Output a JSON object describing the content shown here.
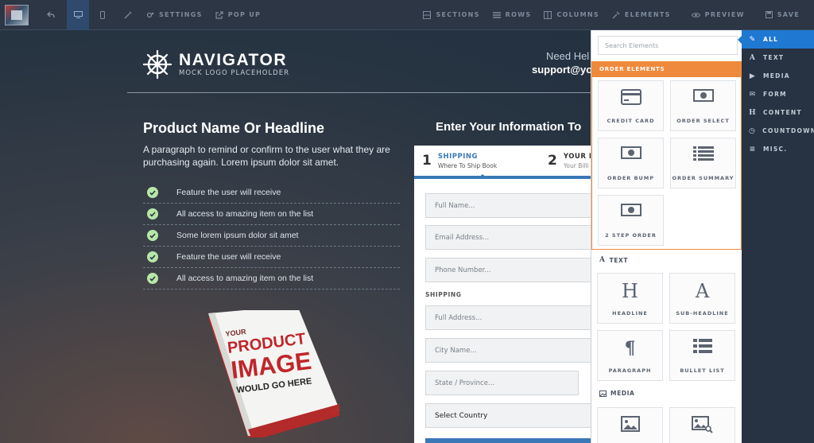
{
  "toolbar": {
    "settings_label": "SETTINGS",
    "popup_label": "POP UP",
    "sections_label": "SECTIONS",
    "rows_label": "ROWS",
    "columns_label": "COLUMNS",
    "elements_label": "ELEMENTS",
    "preview_label": "PREVIEW",
    "save_label": "SAVE"
  },
  "page": {
    "logo_title": "NAVIGATOR",
    "logo_subtitle": "MOCK LOGO PLACEHOLDER",
    "help_text": "Need Hel",
    "help_email": "support@yo",
    "headline": "Product Name Or Headline",
    "paragraph": "A paragraph to remind or confirm to the user what they are purchasing again. Lorem ipsum dolor sit amet.",
    "features": [
      "Feature the user will receive",
      "All access to amazing item on the list",
      "Some lorem ipsum dolor sit amet",
      "Feature the user will receive",
      "All access to amazing item on the list"
    ],
    "book": {
      "line1": "YOUR",
      "line2": "PRODUCT",
      "line3": "IMAGE",
      "line4": "WOULD GO HERE"
    },
    "info_heading": "Enter Your Information To"
  },
  "form": {
    "step1": {
      "num": "1",
      "title": "SHIPPING",
      "sub": "Where To Ship Book"
    },
    "step2": {
      "num": "2",
      "title": "YOUR I",
      "sub": "Your Billi"
    },
    "fullname_placeholder": "Full Name...",
    "email_placeholder": "Email Address...",
    "phone_placeholder": "Phone Number...",
    "shipping_label": "SHIPPING",
    "address_placeholder": "Full Address...",
    "city_placeholder": "City Name...",
    "state_placeholder": "State / Province...",
    "country_value": "Select Country"
  },
  "panel": {
    "search_placeholder": "Search Elements",
    "order_header": "ORDER ELEMENTS",
    "order_tiles": [
      "CREDIT CARD",
      "ORDER SELECT",
      "ORDER BUMP",
      "ORDER SUMMARY",
      "2 STEP ORDER"
    ],
    "text_section": "TEXT",
    "text_tiles": [
      "HEADLINE",
      "SUB-HEADLINE",
      "PARAGRAPH",
      "BULLET LIST"
    ],
    "media_section": "MEDIA"
  },
  "categories": [
    "ALL",
    "TEXT",
    "MEDIA",
    "FORM",
    "CONTENT",
    "COUNTDOWN",
    "MISC."
  ]
}
